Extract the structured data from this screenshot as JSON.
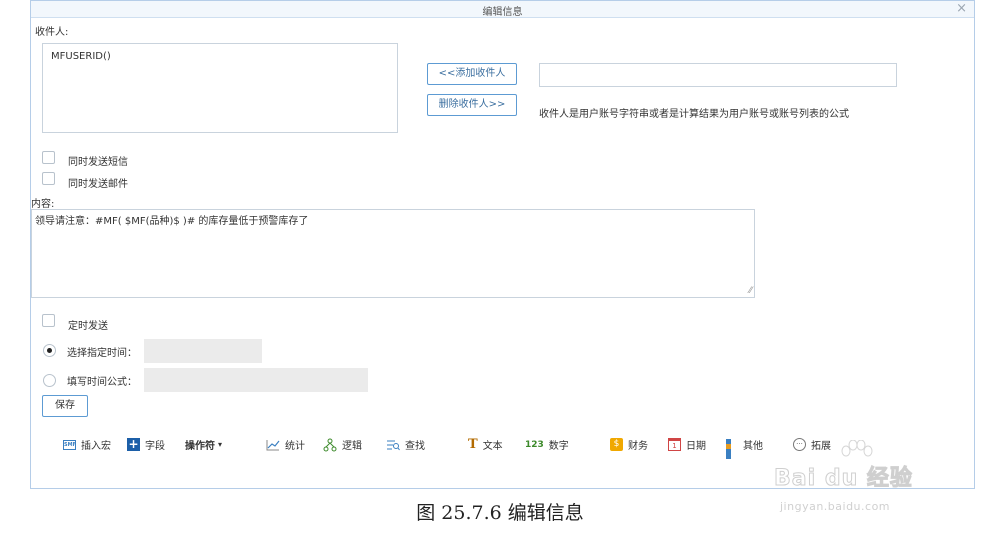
{
  "dialog": {
    "title": "编辑信息",
    "close": "×"
  },
  "recipients": {
    "label": "收件人:",
    "value": "MFUSERID()",
    "add_button": "<<添加收件人",
    "delete_button": "删除收件人>>",
    "input_value": "",
    "hint": "收件人是用户账号字符串或者是计算结果为用户账号或账号列表的公式"
  },
  "options": {
    "send_sms": {
      "label": "同时发送短信",
      "checked": false
    },
    "send_mail": {
      "label": "同时发送邮件",
      "checked": false
    }
  },
  "content": {
    "label": "内容:",
    "value": "领导请注意：#MF( $MF(品种)$ )# 的库存量低于预警库存了"
  },
  "schedule": {
    "timed_send": {
      "label": "定时发送",
      "checked": false
    },
    "specific_time": {
      "label": "选择指定时间：",
      "selected": true,
      "value": ""
    },
    "time_formula": {
      "label": "填写时间公式：",
      "selected": false,
      "value": ""
    }
  },
  "save_button": "保存",
  "toolbar": [
    {
      "label": "插入宏",
      "icon": "macro-icon"
    },
    {
      "label": "字段",
      "icon": "plus-icon"
    },
    {
      "label": "操作符",
      "icon": "caret-down-icon"
    },
    {
      "label": "统计",
      "icon": "line-chart-icon"
    },
    {
      "label": "逻辑",
      "icon": "network-icon"
    },
    {
      "label": "查找",
      "icon": "search-list-icon"
    },
    {
      "label": "文本",
      "icon": "text-icon"
    },
    {
      "label": "数字",
      "icon": "number-icon"
    },
    {
      "label": "财务",
      "icon": "money-icon"
    },
    {
      "label": "日期",
      "icon": "calendar-icon"
    },
    {
      "label": "其他",
      "icon": "grid-icon"
    },
    {
      "label": "拓展",
      "icon": "more-icon"
    }
  ],
  "toolbar_icon_text": {
    "macro": "SMF",
    "plus": "+",
    "caret": "▾",
    "text": "T",
    "number": "123",
    "money": "$",
    "calendar": "1",
    "more": "···"
  },
  "caption": "图 25.7.6  编辑信息",
  "watermark": {
    "brand": "Bai du 经验",
    "url": "jingyan.baidu.com"
  }
}
